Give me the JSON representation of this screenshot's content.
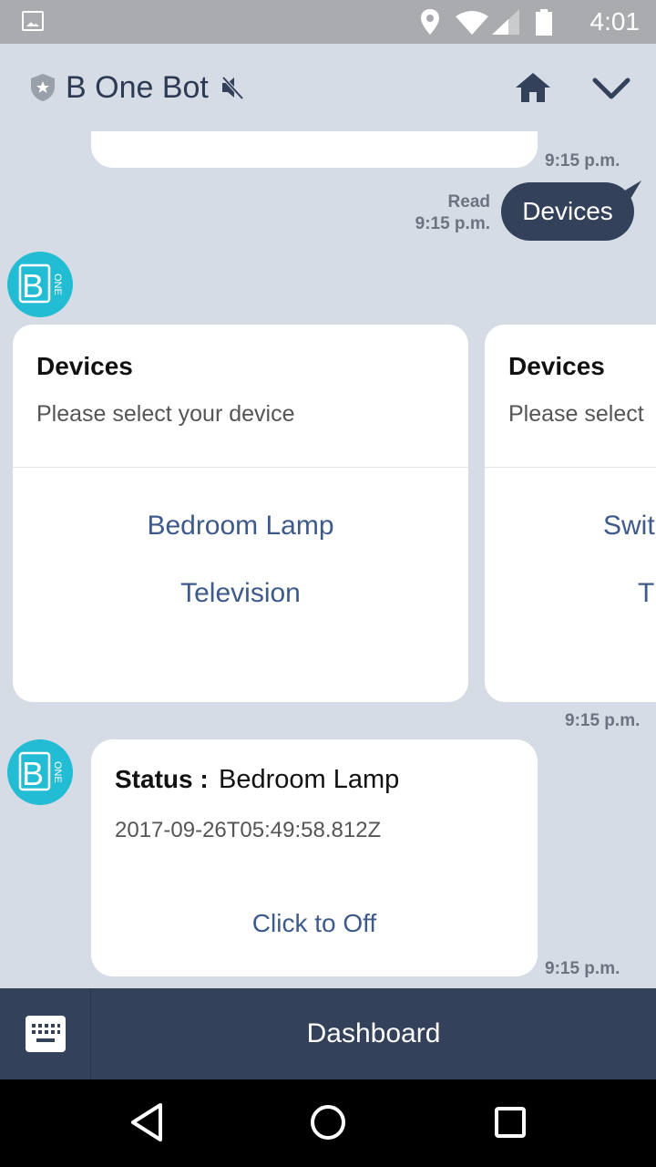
{
  "status_bar": {
    "time": "4:01"
  },
  "header": {
    "title": "B One Bot"
  },
  "chat": {
    "prev_message_time": "9:15 p.m.",
    "user_message": {
      "status": "Read",
      "time": "9:15 p.m.",
      "text": "Devices"
    },
    "bot_avatar_text": "ONE",
    "carousel": {
      "time": "9:15 p.m.",
      "cards": [
        {
          "title": "Devices",
          "subtitle": "Please select your device",
          "buttons": [
            "Bedroom Lamp",
            "Television"
          ]
        },
        {
          "title": "Devices",
          "subtitle": "Please select",
          "buttons": [
            "Swit",
            "T"
          ]
        }
      ]
    },
    "status_card": {
      "label": "Status :",
      "device": "Bedroom Lamp",
      "timestamp": "2017-09-26T05:49:58.812Z",
      "action": "Click to Off",
      "time": "9:15 p.m."
    }
  },
  "bottom_bar": {
    "menu_label": "Dashboard"
  },
  "colors": {
    "header_bg": "#d6dce6",
    "bubble_user": "#34415a",
    "accent": "#22bcd4",
    "link": "#3d5a8a"
  }
}
